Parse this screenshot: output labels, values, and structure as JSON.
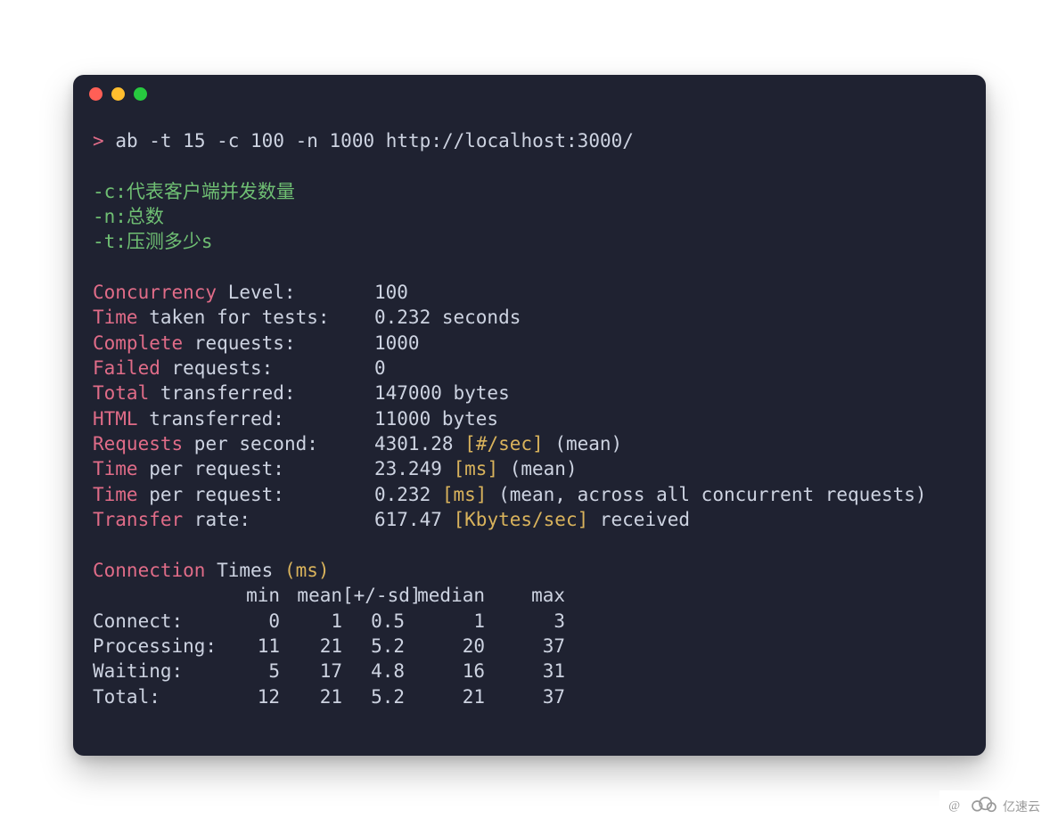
{
  "prompt_symbol": ">",
  "command": "ab -t 15 -c 100 -n 1000 http://localhost:3000/",
  "notes": [
    "-c:代表客户端并发数量",
    "-n:总数",
    "-t:压测多少s"
  ],
  "stats": [
    {
      "key": "Concurrency",
      "rest": " Level:",
      "value": "100",
      "unit": "",
      "suffix": ""
    },
    {
      "key": "Time",
      "rest": " taken for tests:",
      "value": "0.232 seconds",
      "unit": "",
      "suffix": ""
    },
    {
      "key": "Complete",
      "rest": " requests:",
      "value": "1000",
      "unit": "",
      "suffix": ""
    },
    {
      "key": "Failed",
      "rest": " requests:",
      "value": "0",
      "unit": "",
      "suffix": ""
    },
    {
      "key": "Total",
      "rest": " transferred:",
      "value": "147000 bytes",
      "unit": "",
      "suffix": ""
    },
    {
      "key": "HTML",
      "rest": " transferred:",
      "value": "11000 bytes",
      "unit": "",
      "suffix": ""
    },
    {
      "key": "Requests",
      "rest": " per second:",
      "value": "4301.28",
      "unit": "[#/sec]",
      "suffix": " (mean)"
    },
    {
      "key": "Time",
      "rest": " per request:",
      "value": "23.249",
      "unit": "[ms]",
      "suffix": " (mean)"
    },
    {
      "key": "Time",
      "rest": " per request:",
      "value": "0.232",
      "unit": "[ms]",
      "suffix": " (mean, across all concurrent requests)"
    },
    {
      "key": "Transfer",
      "rest": " rate:",
      "value": "617.47",
      "unit": "[Kbytes/sec]",
      "suffix": " received"
    }
  ],
  "conn_heading_key": "Connection",
  "conn_heading_rest": " Times ",
  "conn_heading_unit": "(ms)",
  "conn_header": {
    "min": "min",
    "mean": "mean",
    "sd": "[+/-sd]",
    "median": "median",
    "max": "max"
  },
  "conn_rows": [
    {
      "name": "Connect:",
      "min": "0",
      "mean": "1",
      "sd": "0.5",
      "median": "1",
      "max": "3"
    },
    {
      "name": "Processing:",
      "min": "11",
      "mean": "21",
      "sd": "5.2",
      "median": "20",
      "max": "37"
    },
    {
      "name": "Waiting:",
      "min": "5",
      "mean": "17",
      "sd": "4.8",
      "median": "16",
      "max": "31"
    },
    {
      "name": "Total:",
      "min": "12",
      "mean": "21",
      "sd": "5.2",
      "median": "21",
      "max": "37"
    }
  ],
  "watermark": {
    "at": "@",
    "text": "亿速云"
  }
}
